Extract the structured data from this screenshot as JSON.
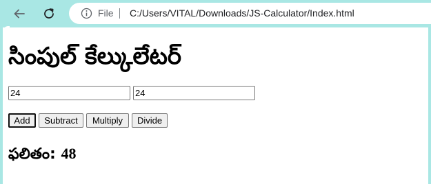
{
  "browser": {
    "scheme_label": "File",
    "url": "C:/Users/VITAL/Downloads/JS-Calculator/Index.html",
    "chrome_color": "#a9e7e4"
  },
  "icons": {
    "back": "back-arrow-icon",
    "reload": "reload-icon",
    "info": "info-icon"
  },
  "page": {
    "title": "సింపుల్ కేల్కులేటర్",
    "input1": {
      "value": "24"
    },
    "input2": {
      "value": "24"
    },
    "buttons": {
      "add": "Add",
      "subtract": "Subtract",
      "multiply": "Multiply",
      "divide": "Divide"
    },
    "result": {
      "label": "ఫలితం: ",
      "value": "48"
    }
  }
}
